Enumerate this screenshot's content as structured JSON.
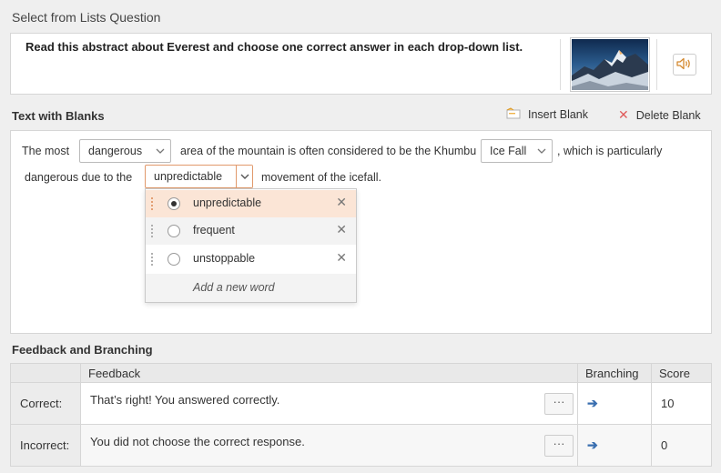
{
  "header": {
    "title": "Select from Lists Question"
  },
  "question": {
    "text": "Read this abstract about Everest and choose one correct answer in each drop-down list."
  },
  "blanks_section": {
    "title": "Text with Blanks",
    "insert_label": "Insert Blank",
    "delete_label": "Delete Blank"
  },
  "sentence": {
    "part1": "The most",
    "part2": "area of the mountain is often considered to be the Khumbu",
    "part3": ", which is particularly",
    "part4": "dangerous due to the",
    "part5": "movement of the icefall."
  },
  "blanks": [
    {
      "value": "dangerous"
    },
    {
      "value": "Ice Fall"
    },
    {
      "value": "unpredictable"
    }
  ],
  "dropdown": {
    "options": [
      {
        "label": "unpredictable",
        "selected": true
      },
      {
        "label": "frequent",
        "selected": false
      },
      {
        "label": "unstoppable",
        "selected": false
      }
    ],
    "add_label": "Add a new word"
  },
  "feedback": {
    "title": "Feedback and Branching",
    "columns": [
      "Feedback",
      "Branching",
      "Score"
    ],
    "rows": [
      {
        "label": "Correct:",
        "text": "That’s right! You answered correctly.",
        "score": "10"
      },
      {
        "label": "Incorrect:",
        "text": "You did not choose the correct response.",
        "score": "0"
      }
    ],
    "ellipsis": "···",
    "arrow": "➔"
  },
  "colors": {
    "accent": "#e1996b",
    "selected_bg": "#fbe5d6",
    "arrow": "#3a6fb0"
  }
}
